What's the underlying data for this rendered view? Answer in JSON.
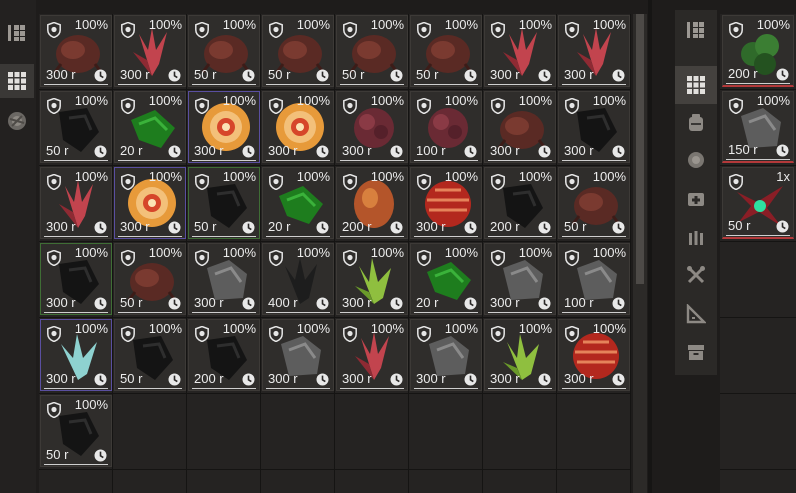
{
  "left_tabs": [
    {
      "icon": "sort-icon",
      "active": false
    },
    {
      "icon": "grid-icon",
      "active": true
    },
    {
      "icon": "artifact-icon",
      "active": false
    }
  ],
  "right_tabs": [
    {
      "icon": "sort-icon",
      "active": false
    },
    {
      "icon": "grid-icon",
      "active": true
    },
    {
      "icon": "backpack-icon",
      "active": false
    },
    {
      "icon": "artifact-icon",
      "active": false
    },
    {
      "icon": "medkit-icon",
      "active": false
    },
    {
      "icon": "ammo-icon",
      "active": false
    },
    {
      "icon": "tools-icon",
      "active": false
    },
    {
      "icon": "ruler-icon",
      "active": false
    },
    {
      "icon": "storage-box-icon",
      "active": false
    }
  ],
  "items": [
    {
      "pct": "100%",
      "price": "300 r",
      "art": "crab"
    },
    {
      "pct": "100%",
      "price": "300 r",
      "art": "crystal"
    },
    {
      "pct": "100%",
      "price": "50 r",
      "art": "crab"
    },
    {
      "pct": "100%",
      "price": "50 r",
      "art": "crab"
    },
    {
      "pct": "100%",
      "price": "50 r",
      "art": "crab"
    },
    {
      "pct": "100%",
      "price": "50 r",
      "art": "crab"
    },
    {
      "pct": "100%",
      "price": "300 r",
      "art": "crystal"
    },
    {
      "pct": "100%",
      "price": "300 r",
      "art": "crystal"
    },
    {
      "pct": "100%",
      "price": "50 r",
      "art": "dark"
    },
    {
      "pct": "100%",
      "price": "20 r",
      "art": "green"
    },
    {
      "pct": "100%",
      "price": "300 r",
      "art": "swirl"
    },
    {
      "pct": "100%",
      "price": "300 r",
      "art": "swirl"
    },
    {
      "pct": "100%",
      "price": "300 r",
      "art": "flower"
    },
    {
      "pct": "100%",
      "price": "100 r",
      "art": "flower"
    },
    {
      "pct": "100%",
      "price": "300 r",
      "art": "crab"
    },
    {
      "pct": "100%",
      "price": "300 r",
      "art": "dark"
    },
    {
      "pct": "100%",
      "price": "300 r",
      "art": "crystal"
    },
    {
      "pct": "100%",
      "price": "300 r",
      "art": "swirl"
    },
    {
      "pct": "100%",
      "price": "50 r",
      "art": "dark"
    },
    {
      "pct": "100%",
      "price": "20 r",
      "art": "green"
    },
    {
      "pct": "100%",
      "price": "200 r",
      "art": "orb"
    },
    {
      "pct": "100%",
      "price": "300 r",
      "art": "redball"
    },
    {
      "pct": "100%",
      "price": "200 r",
      "art": "dark"
    },
    {
      "pct": "100%",
      "price": "50 r",
      "art": "crab"
    },
    {
      "pct": "100%",
      "price": "300 r",
      "art": "dark"
    },
    {
      "pct": "100%",
      "price": "50 r",
      "art": "crab"
    },
    {
      "pct": "100%",
      "price": "300 r",
      "art": "grey"
    },
    {
      "pct": "100%",
      "price": "400 r",
      "art": "spiky"
    },
    {
      "pct": "100%",
      "price": "300 r",
      "art": "lime"
    },
    {
      "pct": "100%",
      "price": "20 r",
      "art": "green"
    },
    {
      "pct": "100%",
      "price": "300 r",
      "art": "grey"
    },
    {
      "pct": "100%",
      "price": "100 r",
      "art": "grey"
    },
    {
      "pct": "100%",
      "price": "300 r",
      "art": "ice"
    },
    {
      "pct": "100%",
      "price": "50 r",
      "art": "dark"
    },
    {
      "pct": "100%",
      "price": "200 r",
      "art": "dark"
    },
    {
      "pct": "100%",
      "price": "300 r",
      "art": "grey"
    },
    {
      "pct": "100%",
      "price": "300 r",
      "art": "crystal"
    },
    {
      "pct": "100%",
      "price": "300 r",
      "art": "grey"
    },
    {
      "pct": "100%",
      "price": "300 r",
      "art": "lime"
    },
    {
      "pct": "100%",
      "price": "300 r",
      "art": "redball"
    },
    {
      "pct": "100%",
      "price": "50 r",
      "art": "dark"
    }
  ],
  "right_items": [
    {
      "pct": "100%",
      "price": "200 r",
      "art": "greenclump"
    },
    {
      "pct": "100%",
      "price": "150 r",
      "art": "grey"
    },
    {
      "pct": "1x",
      "price": "50 r",
      "art": "thorn"
    }
  ],
  "colors": {
    "accent_selected": "#5a4fa0",
    "green_outline": "#3f6e35",
    "red_line": "#b3393a"
  }
}
